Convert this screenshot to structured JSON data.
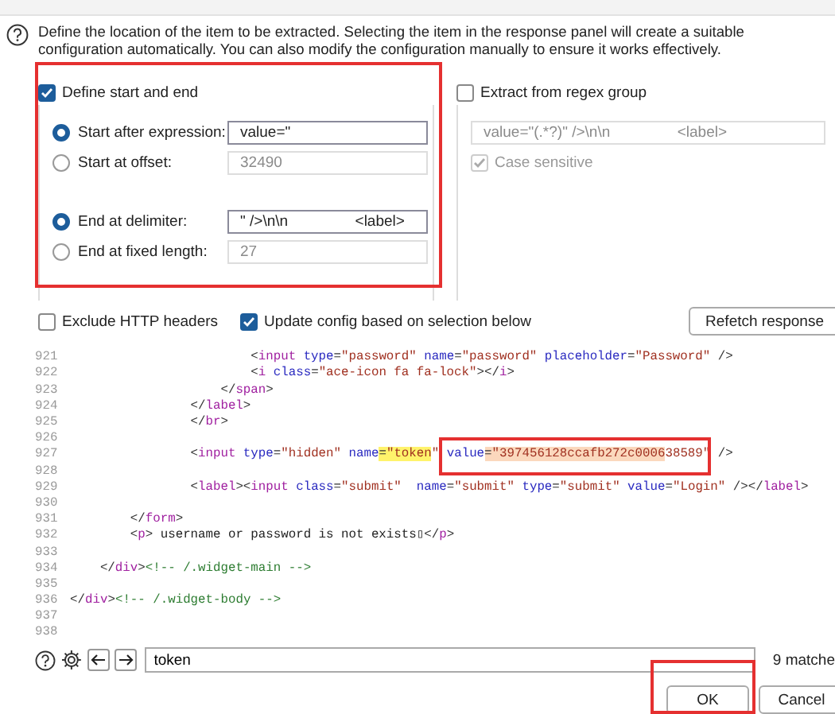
{
  "description": "Define the location of the item to be extracted. Selecting the item in the response panel will create a suitable configuration automatically. You can also modify the configuration manually to ensure it works effectively.",
  "start_end": {
    "label": "Define start and end",
    "checked": true,
    "start_options": [
      {
        "label": "Start after expression:",
        "selected": true,
        "value": "value=\"",
        "disabled": false
      },
      {
        "label": "Start at offset:",
        "selected": false,
        "value": "32490",
        "disabled": true
      }
    ],
    "end_options": [
      {
        "label": "End at delimiter:",
        "selected": true,
        "value": "\" />\\n\\n                <label>",
        "disabled": false
      },
      {
        "label": "End at fixed length:",
        "selected": false,
        "value": "27",
        "disabled": true
      }
    ]
  },
  "regex_group": {
    "label": "Extract from regex group",
    "checked": false,
    "value": "value=\"(.*?)\" />\\n\\n                <label>",
    "case_sensitive": {
      "label": "Case sensitive",
      "checked": true,
      "disabled": true
    }
  },
  "options": [
    {
      "label": "Exclude HTTP headers",
      "checked": false
    },
    {
      "label": "Update config based on selection below",
      "checked": true
    }
  ],
  "refetch_button": "Refetch response",
  "code_lines": [
    {
      "number": "921",
      "segments": [
        {
          "kind": "punct",
          "text": "                        <"
        },
        {
          "kind": "tag",
          "text": "input"
        },
        {
          "kind": "attr",
          "text": " type"
        },
        {
          "kind": "punct",
          "text": "="
        },
        {
          "kind": "string",
          "text": "\"password\""
        },
        {
          "kind": "attr",
          "text": " name"
        },
        {
          "kind": "punct",
          "text": "="
        },
        {
          "kind": "string",
          "text": "\"password\""
        },
        {
          "kind": "attr",
          "text": " placeholder"
        },
        {
          "kind": "punct",
          "text": "="
        },
        {
          "kind": "string",
          "text": "\"Password\""
        },
        {
          "kind": "punct",
          "text": " />"
        }
      ]
    },
    {
      "number": "922",
      "segments": [
        {
          "kind": "punct",
          "text": "                        <"
        },
        {
          "kind": "tag",
          "text": "i"
        },
        {
          "kind": "attr",
          "text": " class"
        },
        {
          "kind": "punct",
          "text": "="
        },
        {
          "kind": "string",
          "text": "\"ace-icon fa fa-lock\""
        },
        {
          "kind": "punct",
          "text": "></"
        },
        {
          "kind": "tag",
          "text": "i"
        },
        {
          "kind": "punct",
          "text": ">"
        }
      ]
    },
    {
      "number": "923",
      "segments": [
        {
          "kind": "punct",
          "text": "                    </"
        },
        {
          "kind": "tag",
          "text": "span"
        },
        {
          "kind": "punct",
          "text": ">"
        }
      ]
    },
    {
      "number": "924",
      "segments": [
        {
          "kind": "punct",
          "text": "                </"
        },
        {
          "kind": "tag",
          "text": "label"
        },
        {
          "kind": "punct",
          "text": ">"
        }
      ]
    },
    {
      "number": "925",
      "segments": [
        {
          "kind": "punct",
          "text": "                </"
        },
        {
          "kind": "tag",
          "text": "br"
        },
        {
          "kind": "punct",
          "text": ">"
        }
      ]
    },
    {
      "number": "926"
    },
    {
      "number": "927",
      "segments": [
        {
          "kind": "punct",
          "text": "                <",
          "matched": false,
          "selected": false
        },
        {
          "kind": "tag",
          "text": "input",
          "matched": false,
          "selected": false
        },
        {
          "kind": "attr",
          "text": " type",
          "matched": false,
          "selected": false
        },
        {
          "kind": "punct",
          "text": "=",
          "matched": false,
          "selected": false
        },
        {
          "kind": "string",
          "text": "\"hidden\"",
          "matched": false,
          "selected": false
        },
        {
          "kind": "attr",
          "text": " name",
          "matched": false,
          "selected": false
        },
        {
          "kind": "punct",
          "text": "=",
          "matched": true,
          "selected": false
        },
        {
          "kind": "string",
          "text": "\"token",
          "matched": true,
          "selected": false
        },
        {
          "kind": "string",
          "text": "\"",
          "matched": false,
          "selected": false
        },
        {
          "kind": "attr",
          "text": " value",
          "matched": false,
          "selected": false
        },
        {
          "kind": "punct",
          "text": "=",
          "matched": false,
          "selected": true
        },
        {
          "kind": "string",
          "text": "\"397456128ccafb272c0006",
          "matched": false,
          "selected": true
        },
        {
          "kind": "string",
          "text": "38589\"",
          "matched": false,
          "selected": false
        },
        {
          "kind": "punct",
          "text": " />",
          "matched": false,
          "selected": false
        }
      ]
    },
    {
      "number": "928"
    },
    {
      "number": "929",
      "segments": [
        {
          "kind": "punct",
          "text": "                <"
        },
        {
          "kind": "tag",
          "text": "label"
        },
        {
          "kind": "punct",
          "text": "><"
        },
        {
          "kind": "tag",
          "text": "input"
        },
        {
          "kind": "attr",
          "text": " class"
        },
        {
          "kind": "punct",
          "text": "="
        },
        {
          "kind": "string",
          "text": "\"submit\""
        },
        {
          "kind": "attr",
          "text": "  name"
        },
        {
          "kind": "punct",
          "text": "="
        },
        {
          "kind": "string",
          "text": "\"submit\""
        },
        {
          "kind": "attr",
          "text": " type"
        },
        {
          "kind": "punct",
          "text": "="
        },
        {
          "kind": "string",
          "text": "\"submit\""
        },
        {
          "kind": "attr",
          "text": " value"
        },
        {
          "kind": "punct",
          "text": "="
        },
        {
          "kind": "string",
          "text": "\"Login\""
        },
        {
          "kind": "punct",
          "text": " /></"
        },
        {
          "kind": "tag",
          "text": "label"
        },
        {
          "kind": "punct",
          "text": ">"
        }
      ]
    },
    {
      "number": "930"
    },
    {
      "number": "931",
      "segments": [
        {
          "kind": "punct",
          "text": "        </"
        },
        {
          "kind": "tag",
          "text": "form"
        },
        {
          "kind": "punct",
          "text": ">"
        }
      ]
    },
    {
      "number": "932",
      "segments": [
        {
          "kind": "punct",
          "text": "        <"
        },
        {
          "kind": "tag",
          "text": "p"
        },
        {
          "kind": "punct",
          "text": ">"
        },
        {
          "kind": "plain",
          "text": " username or password is not exists▯"
        },
        {
          "kind": "punct",
          "text": "</"
        },
        {
          "kind": "tag",
          "text": "p"
        },
        {
          "kind": "punct",
          "text": ">"
        }
      ]
    },
    {
      "number": "933"
    },
    {
      "number": "934",
      "segments": [
        {
          "kind": "punct",
          "text": "    </"
        },
        {
          "kind": "tag",
          "text": "div"
        },
        {
          "kind": "punct",
          "text": ">"
        },
        {
          "kind": "comment",
          "text": "<!-- /.widget-main -->"
        }
      ]
    },
    {
      "number": "935"
    },
    {
      "number": "936",
      "segments": [
        {
          "kind": "punct",
          "text": "</"
        },
        {
          "kind": "tag",
          "text": "div"
        },
        {
          "kind": "punct",
          "text": ">"
        },
        {
          "kind": "comment",
          "text": "<!-- /.widget-body -->"
        }
      ]
    },
    {
      "number": "937"
    },
    {
      "number": "938"
    }
  ],
  "search": {
    "value": "token",
    "matches": "9 matche"
  },
  "buttons": [
    "OK",
    "Cancel"
  ]
}
